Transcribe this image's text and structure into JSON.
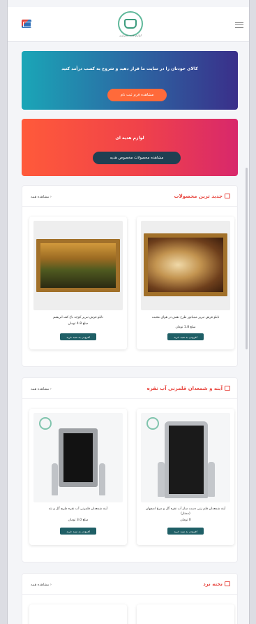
{
  "header": {
    "cart_icon": "shopping-bag-icon",
    "logo_caption": "لوازم هدیه شیرازی",
    "menu_icon": "hamburger-menu-icon"
  },
  "banners": {
    "signup": {
      "text": "کالای خودتان را در سایت ما قرار دهید و شروع به کسب درآمد کنید",
      "button": "مشاهده فرم ثبت نام",
      "gradient": [
        "#1aa6b7",
        "#3a2f8a"
      ]
    },
    "gifts": {
      "text": "لوازم هدیه ای",
      "button": "مشاهده محصولات مخصوص هدیه",
      "gradient": [
        "#ff5a3a",
        "#d8286b"
      ]
    }
  },
  "sections": [
    {
      "title": "جدید ترین محصولات",
      "icon": "basket-icon",
      "view_all": "مشاهده همه",
      "products": [
        {
          "title": "تابلو فرش تبریز مینیاتور طرح نقش در هوای محبت",
          "price": "مبلغ 1.8 تومان",
          "button": "افزودن به سبد خرید"
        },
        {
          "title": "تابلو فرش تبریز کوچه باغ کف ابریشم",
          "price": "مبلغ 4.8 تومان",
          "button": "افزودن به سبد خرید"
        }
      ]
    },
    {
      "title": "آینه و شمعدان قلمزنی آب نقره",
      "icon": "gift-icon",
      "view_all": "مشاهده همه",
      "products": [
        {
          "title": "آینه شمعدان قلم زنی دست ساز آب نقره گل و مرغ اصفهان (ممتاز)",
          "price": "0 تومان",
          "button": "افزودن به سبد خرید"
        },
        {
          "title": "آینه شمعدان قلمزنی آب نقره طرح گل و بته",
          "price": "مبلغ 3.0 تومان",
          "button": "افزودن به سبد خرید"
        }
      ]
    },
    {
      "title": "تخته نرد",
      "icon": "gift-icon",
      "view_all": "مشاهده همه"
    }
  ],
  "colors": {
    "accent_red": "#e8463f",
    "button_teal": "#1f5f66",
    "button_orange": "#ff6a3a"
  }
}
